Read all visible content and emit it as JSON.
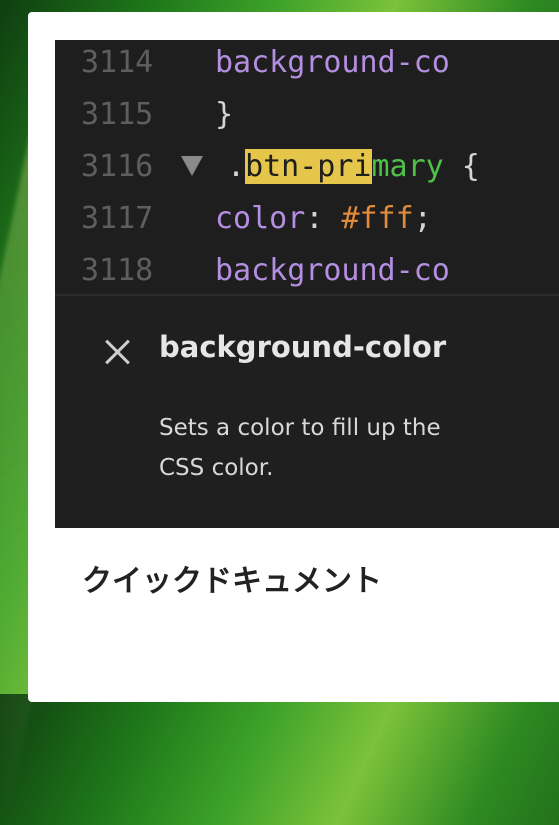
{
  "editor": {
    "lines": [
      {
        "number": "3114",
        "parts": [
          {
            "cls": "prop",
            "text": "    background-co"
          }
        ]
      },
      {
        "number": "3115",
        "parts": [
          {
            "cls": "punc",
            "text": "  }"
          }
        ]
      },
      {
        "number": "3116",
        "parts": [
          {
            "cls": "punc",
            "text": "."
          },
          {
            "cls": "hl",
            "text": "btn-pri"
          },
          {
            "cls": "sel",
            "text": "mary"
          },
          {
            "cls": "punc",
            "text": " {"
          }
        ]
      },
      {
        "number": "3117",
        "parts": [
          {
            "cls": "prop",
            "text": "    color"
          },
          {
            "cls": "punc",
            "text": ": "
          },
          {
            "cls": "val",
            "text": "#fff"
          },
          {
            "cls": "punc",
            "text": ";"
          }
        ]
      },
      {
        "number": "3118",
        "parts": [
          {
            "cls": "prop",
            "text": "    background-co"
          }
        ]
      }
    ]
  },
  "quick_doc": {
    "title": "background-color",
    "description_line1": "Sets a color to fill up the",
    "description_line2": "CSS color."
  },
  "caption": "クイックドキュメント",
  "colors": {
    "editor_bg": "#1e1e1e",
    "property": "#b48ee0",
    "selector": "#4fc14a",
    "highlight": "#e5c54a",
    "value": "#e08a3a"
  }
}
